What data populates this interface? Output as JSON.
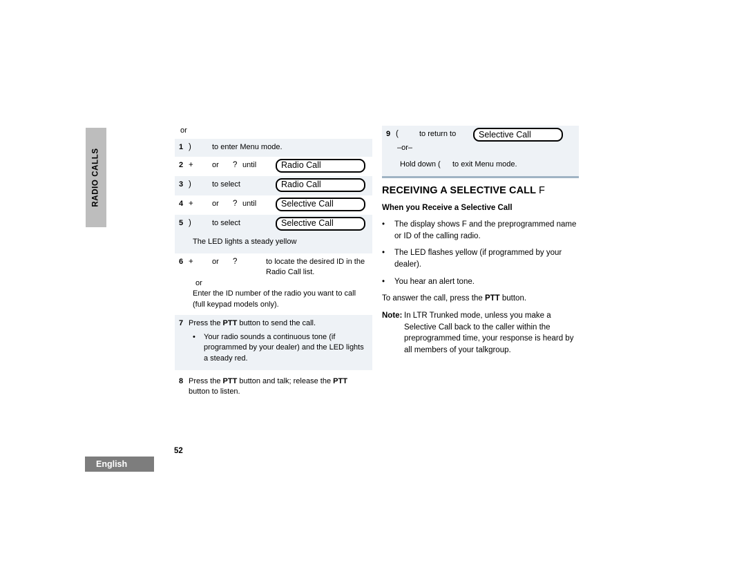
{
  "chapter_tab": {
    "label": "RADIO CALLS"
  },
  "footer": {
    "language": "English",
    "page_number": "52"
  },
  "left_column": {
    "pre_or": "or",
    "steps": [
      {
        "num": "1",
        "glyph": ")",
        "text": "to enter Menu mode."
      },
      {
        "num": "2",
        "glyph": "+",
        "or_text": "or",
        "glyph2": "?",
        "until_text": "until",
        "lcd": "Radio Call"
      },
      {
        "num": "3",
        "glyph": ")",
        "text": "to select",
        "lcd": "Radio Call"
      },
      {
        "num": "4",
        "glyph": "+",
        "or_text": "or",
        "glyph2": "?",
        "until_text": "until",
        "lcd": "Selective Call"
      },
      {
        "num": "5",
        "glyph": ")",
        "text": "to select",
        "lcd": "Selective Call"
      }
    ],
    "led_note": "The LED lights a steady yellow",
    "step6": {
      "num": "6",
      "glyph": "+",
      "or_text": "or",
      "glyph2": "?",
      "text": "to locate the desired ID in the Radio Call list.",
      "sub_or": "or",
      "alt_text": "Enter the ID number of the radio you want to call (full keypad models only)."
    },
    "step7": {
      "num": "7",
      "text_pre": "Press the ",
      "text_bold": "PTT",
      "text_post": " button to send the call.",
      "bullet": "Your radio sounds a continuous tone (if programmed by your dealer) and the LED lights a steady red."
    },
    "step8": {
      "num": "8",
      "text_pre": "Press the ",
      "bold1": "PTT",
      "text_mid": " button and talk; release the ",
      "bold2": "PTT",
      "text_post": " button to listen."
    }
  },
  "right_column": {
    "step9": {
      "num": "9",
      "glyph": "(",
      "text": "to return to",
      "lcd": "Selective Call",
      "or_separator": "–or–",
      "hold_text_pre": "Hold down (",
      "hold_text_post": "to exit Menu mode."
    },
    "section_heading": "RECEIVING A SELECTIVE CALL",
    "section_heading_glyph": "F",
    "sub_heading": "When you Receive a Selective Call",
    "bullets": [
      "The display shows  F  and the preprogrammed name or ID of the calling radio.",
      "The LED flashes yellow (if programmed by your dealer).",
      "You hear an alert tone."
    ],
    "answer_pre": "To answer the call, press the ",
    "answer_bold": "PTT",
    "answer_post": " button.",
    "note_label": "Note:",
    "note_body": "In LTR Trunked mode, unless you make a Selective Call back to the caller within the preprogrammed time, your response is heard by all members of your talkgroup."
  },
  "colors": {
    "row_shade": "#eef2f6",
    "tab_gray": "#bdbdbd",
    "badge_gray": "#7d7d7d",
    "rule_blue": "#9fb3c4"
  }
}
